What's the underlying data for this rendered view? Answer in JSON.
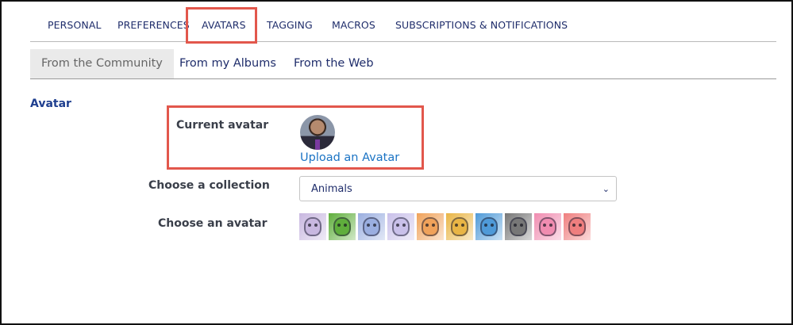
{
  "top_nav": {
    "items": [
      "PERSONAL",
      "PREFERENCES",
      "AVATARS",
      "TAGGING",
      "MACROS",
      "SUBSCRIPTIONS & NOTIFICATIONS"
    ],
    "selected": "AVATARS"
  },
  "sub_tabs": {
    "items": [
      "From the Community",
      "From my Albums",
      "From the Web"
    ],
    "active": "From the Community"
  },
  "avatar_section": {
    "title": "Avatar",
    "current_avatar_label": "Current avatar",
    "upload_link": "Upload an Avatar",
    "collection_label": "Choose a collection",
    "collection_value": "Animals",
    "choose_avatar_label": "Choose an avatar",
    "avatar_options": [
      {
        "name": "dog-avatar",
        "color": "#c8b7e0"
      },
      {
        "name": "frog-avatar",
        "color": "#5fae3c"
      },
      {
        "name": "bulldog-avatar",
        "color": "#9aaee0"
      },
      {
        "name": "elephant-avatar",
        "color": "#c9c0ea"
      },
      {
        "name": "tiger-avatar",
        "color": "#f0a25a"
      },
      {
        "name": "giraffe-avatar",
        "color": "#e9b545"
      },
      {
        "name": "hippo-avatar",
        "color": "#4f9ad8"
      },
      {
        "name": "gorilla-avatar",
        "color": "#777777"
      },
      {
        "name": "pig-avatar",
        "color": "#f08cb0"
      },
      {
        "name": "rabbit-avatar",
        "color": "#ef7e7e"
      }
    ]
  },
  "colors": {
    "highlight": "#e2574c",
    "nav_text": "#1f2d6b",
    "link": "#1a73c4"
  }
}
